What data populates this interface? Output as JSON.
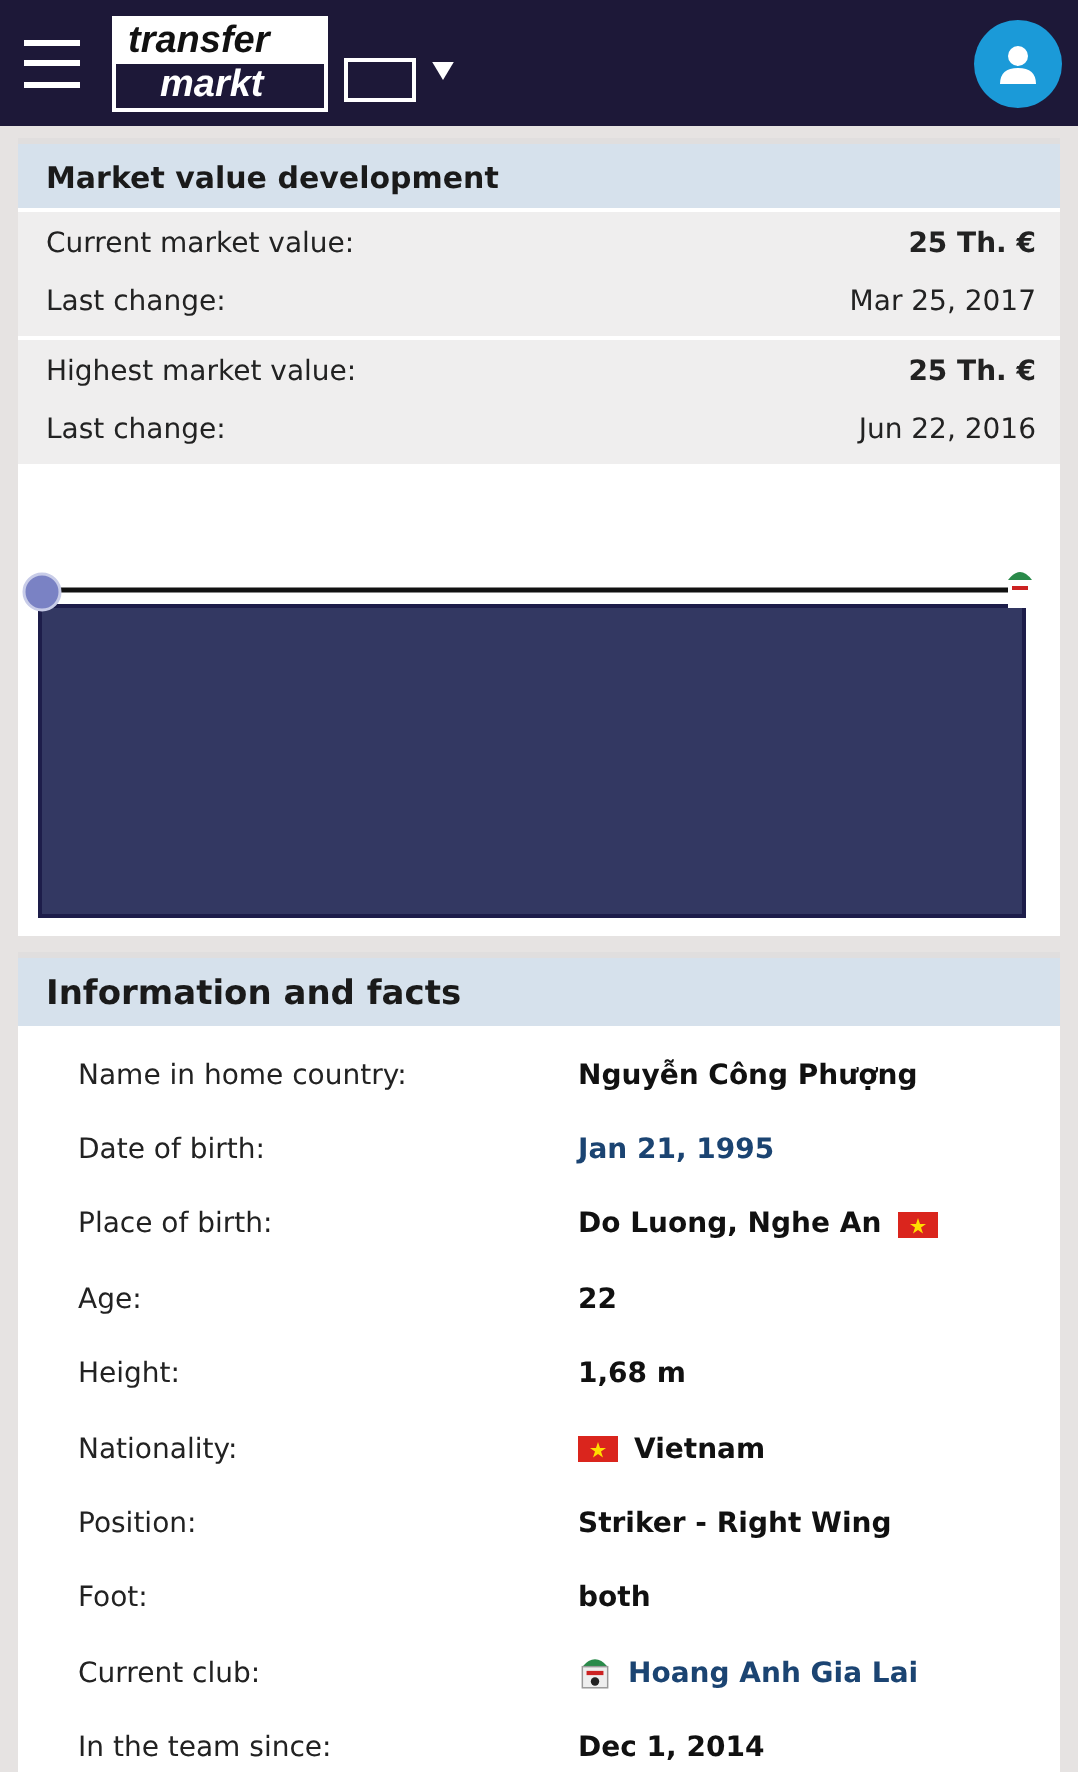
{
  "header": {
    "logo": [
      "transfer",
      "markt"
    ]
  },
  "market_value": {
    "title": "Market value development",
    "groups": [
      {
        "rows": [
          {
            "label": "Current market value:",
            "value": "25 Th. €",
            "bold": true
          },
          {
            "label": "Last change:",
            "value": "Mar 25, 2017",
            "bold": false
          }
        ]
      },
      {
        "rows": [
          {
            "label": "Highest market value:",
            "value": "25 Th. €",
            "bold": true
          },
          {
            "label": "Last change:",
            "value": "Jun 22, 2016",
            "bold": false
          }
        ]
      }
    ]
  },
  "facts": {
    "title": "Information and facts",
    "rows": [
      {
        "label": "Name in home country:",
        "value": "Nguyễn Công Phượng",
        "kind": "text"
      },
      {
        "label": "Date of birth:",
        "value": "Jan 21, 1995",
        "kind": "link"
      },
      {
        "label": "Place of birth:",
        "value": "Do Luong, Nghe An",
        "kind": "flag_after"
      },
      {
        "label": "Age:",
        "value": "22",
        "kind": "text"
      },
      {
        "label": "Height:",
        "value": "1,68 m",
        "kind": "text"
      },
      {
        "label": "Nationality:",
        "value": "Vietnam",
        "kind": "flag_before"
      },
      {
        "label": "Position:",
        "value": "Striker - Right Wing",
        "kind": "text"
      },
      {
        "label": "Foot:",
        "value": "both",
        "kind": "text"
      },
      {
        "label": "Current club:",
        "value": "Hoang Anh Gia Lai",
        "kind": "club_link"
      },
      {
        "label": "In the team since:",
        "value": "Dec 1, 2014",
        "kind": "text"
      }
    ]
  }
}
